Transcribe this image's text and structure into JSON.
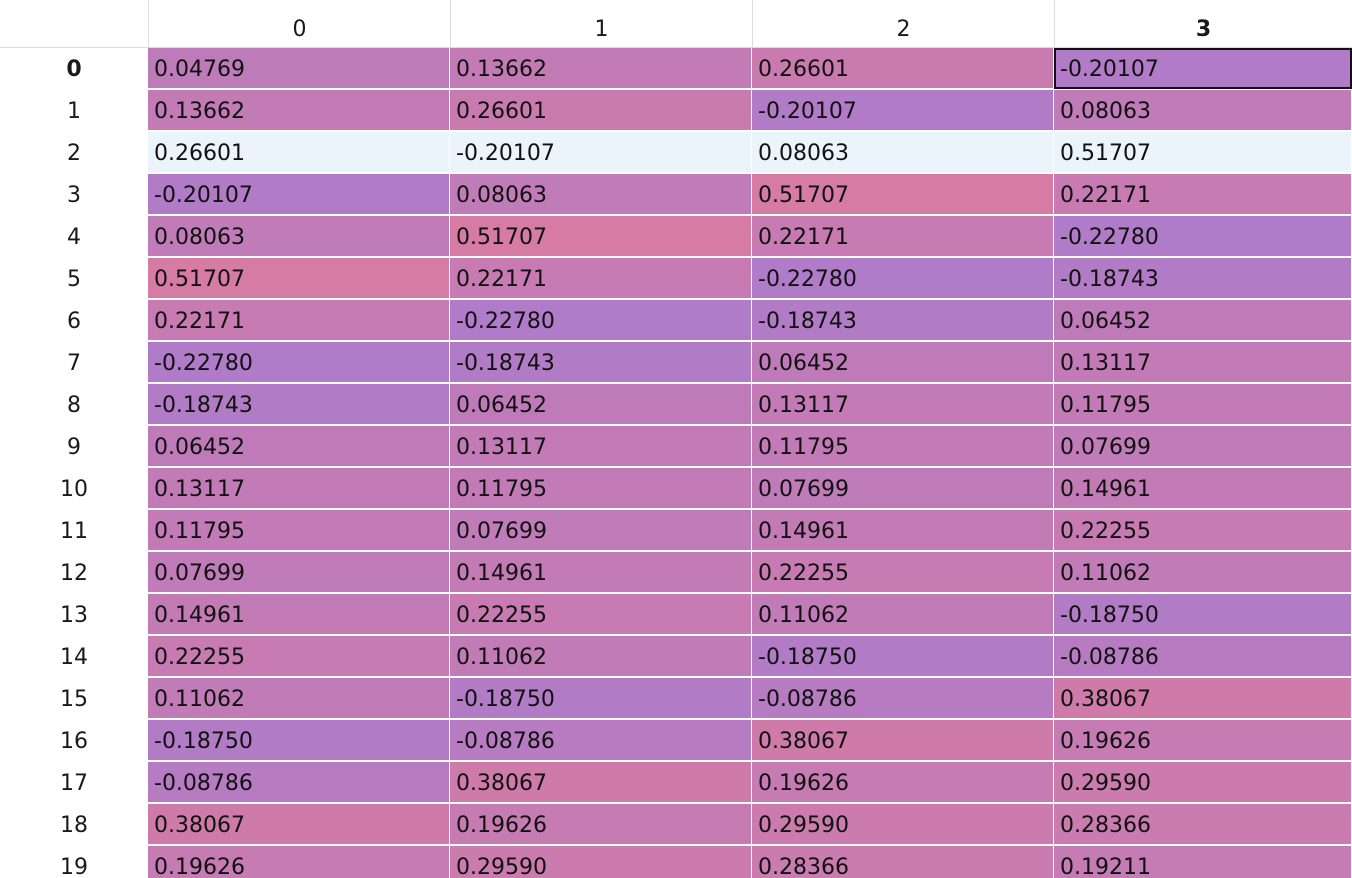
{
  "columns": [
    "0",
    "1",
    "2",
    "3"
  ],
  "active_column": 3,
  "active_row": 0,
  "selected_cell": {
    "row": 0,
    "col": 3
  },
  "highlighted_row": 2,
  "colors": {
    "highlight_row": "#ebf4fb",
    "low": "#b07bc8",
    "high": "#d67ba3"
  },
  "rows": [
    {
      "label": "0",
      "values": [
        "0.04769",
        "0.13662",
        "0.26601",
        "-0.20107"
      ]
    },
    {
      "label": "1",
      "values": [
        "0.13662",
        "0.26601",
        "-0.20107",
        "0.08063"
      ]
    },
    {
      "label": "2",
      "values": [
        "0.26601",
        "-0.20107",
        "0.08063",
        "0.51707"
      ]
    },
    {
      "label": "3",
      "values": [
        "-0.20107",
        "0.08063",
        "0.51707",
        "0.22171"
      ]
    },
    {
      "label": "4",
      "values": [
        "0.08063",
        "0.51707",
        "0.22171",
        "-0.22780"
      ]
    },
    {
      "label": "5",
      "values": [
        "0.51707",
        "0.22171",
        "-0.22780",
        "-0.18743"
      ]
    },
    {
      "label": "6",
      "values": [
        "0.22171",
        "-0.22780",
        "-0.18743",
        "0.06452"
      ]
    },
    {
      "label": "7",
      "values": [
        "-0.22780",
        "-0.18743",
        "0.06452",
        "0.13117"
      ]
    },
    {
      "label": "8",
      "values": [
        "-0.18743",
        "0.06452",
        "0.13117",
        "0.11795"
      ]
    },
    {
      "label": "9",
      "values": [
        "0.06452",
        "0.13117",
        "0.11795",
        "0.07699"
      ]
    },
    {
      "label": "10",
      "values": [
        "0.13117",
        "0.11795",
        "0.07699",
        "0.14961"
      ]
    },
    {
      "label": "11",
      "values": [
        "0.11795",
        "0.07699",
        "0.14961",
        "0.22255"
      ]
    },
    {
      "label": "12",
      "values": [
        "0.07699",
        "0.14961",
        "0.22255",
        "0.11062"
      ]
    },
    {
      "label": "13",
      "values": [
        "0.14961",
        "0.22255",
        "0.11062",
        "-0.18750"
      ]
    },
    {
      "label": "14",
      "values": [
        "0.22255",
        "0.11062",
        "-0.18750",
        "-0.08786"
      ]
    },
    {
      "label": "15",
      "values": [
        "0.11062",
        "-0.18750",
        "-0.08786",
        "0.38067"
      ]
    },
    {
      "label": "16",
      "values": [
        "-0.18750",
        "-0.08786",
        "0.38067",
        "0.19626"
      ]
    },
    {
      "label": "17",
      "values": [
        "-0.08786",
        "0.38067",
        "0.19626",
        "0.29590"
      ]
    },
    {
      "label": "18",
      "values": [
        "0.38067",
        "0.19626",
        "0.29590",
        "0.28366"
      ]
    },
    {
      "label": "19",
      "values": [
        "0.19626",
        "0.29590",
        "0.28366",
        "0.19211"
      ]
    }
  ]
}
